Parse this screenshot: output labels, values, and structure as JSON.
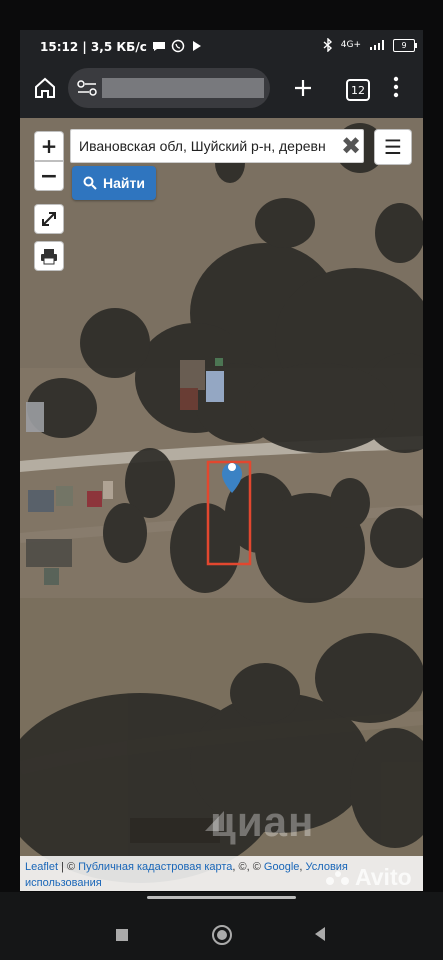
{
  "status_bar": {
    "time_info": "15:12 | 3,5 КБ/с",
    "network": "4G+",
    "battery": "9"
  },
  "browser": {
    "tab_count": "12",
    "icons": [
      "home-icon",
      "site-settings-icon",
      "plus-icon",
      "tabs-icon",
      "more-icon"
    ]
  },
  "map": {
    "zoom_in": "+",
    "zoom_out": "−",
    "search_value": "Ивановская обл, Шуйский р-н, деревн",
    "clear_label": "✖",
    "find_label": "Найти",
    "menu_label": "☰",
    "attribution": {
      "leaflet": "Leaflet",
      "separator": " | © ",
      "cadastral": "Публичная кадастровая карта",
      "copyright_sep": ", ©, © ",
      "google": "Google",
      "terms_sep": ", ",
      "terms_line_1": "Условия",
      "terms_line_2": "использования"
    },
    "marker_color": "#3b82c4",
    "plot_color": "#e2472f"
  },
  "watermarks": {
    "cian": "циан",
    "avito": "Avito"
  }
}
